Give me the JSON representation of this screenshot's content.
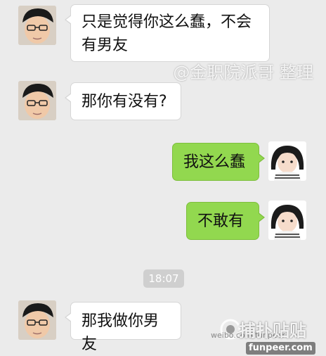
{
  "messages": [
    {
      "side": "in",
      "text_lines": [
        "只是觉得你这么蠢，不会",
        "有男友"
      ],
      "avatar": "boy-avatar"
    },
    {
      "side": "in",
      "text": "那你有没有?",
      "avatar": "boy-avatar"
    },
    {
      "side": "out",
      "text": "我这么蠢",
      "avatar": "girl-avatar"
    },
    {
      "side": "out",
      "text": "不敢有",
      "avatar": "girl-avatar"
    },
    {
      "side": "in",
      "text": "那我做你男友",
      "avatar": "boy-avatar"
    }
  ],
  "timestamp": "18:07",
  "watermarks": {
    "top": "@金职院派哥 整理",
    "weibo": "weibo.com/funpeer",
    "site_cn": "捕扑贴贴",
    "site": "funpeer.com"
  },
  "colors": {
    "background": "#ebebeb",
    "incoming_bubble": "#ffffff",
    "outgoing_bubble": "#92d84f",
    "timestamp_bg": "#cfcfcf"
  }
}
